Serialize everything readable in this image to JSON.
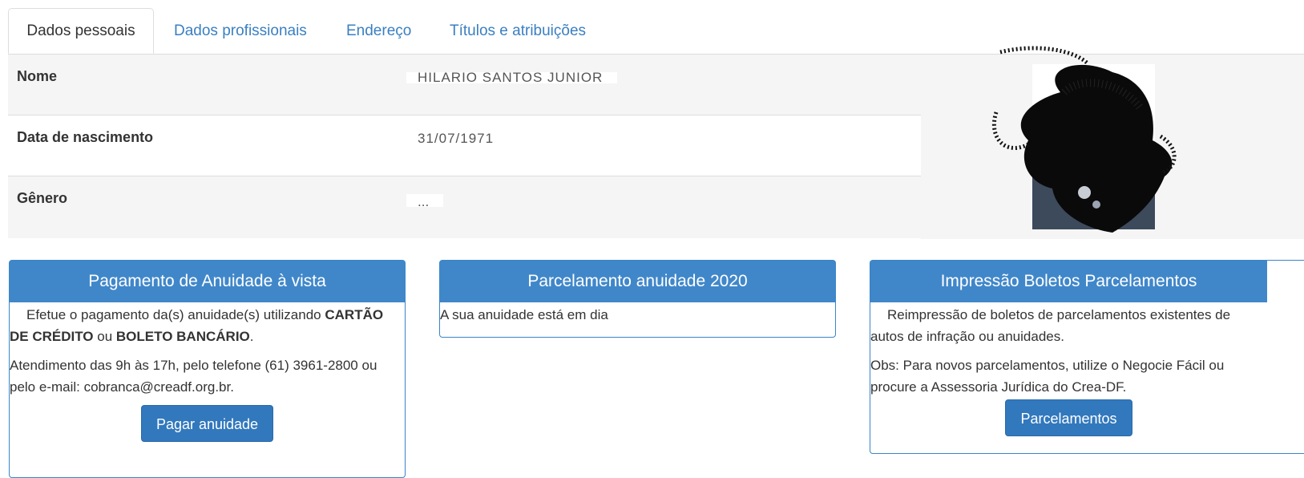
{
  "tabs": [
    {
      "label": "Dados pessoais",
      "active": true
    },
    {
      "label": "Dados profissionais",
      "active": false
    },
    {
      "label": "Endereço",
      "active": false
    },
    {
      "label": "Títulos e atribuições",
      "active": false
    }
  ],
  "personal": {
    "rows": [
      {
        "label": "Nome",
        "value": "HILARIO SANTOS JUNIOR"
      },
      {
        "label": "Data de nascimento",
        "value": "31/07/1971"
      },
      {
        "label": "Gênero",
        "value": "..."
      }
    ]
  },
  "panels": {
    "payment": {
      "title": "Pagamento de Anuidade à vista",
      "line1_pre": "Efetue o pagamento da(s) anuidade(s) utilizando ",
      "bold1": "CARTÃO DE CRÉDITO",
      "mid": " ou ",
      "bold2": "BOLETO BANCÁRIO",
      "end": ".",
      "line2": "Atendimento das 9h às 17h, pelo telefone (61) 3961-2800 ou pelo e-mail: cobranca@creadf.org.br.",
      "button": "Pagar anuidade"
    },
    "installment": {
      "title": "Parcelamento anuidade 2020",
      "text": "A sua anuidade está em dia"
    },
    "reprint": {
      "title": "Impressão Boletos Parcelamentos",
      "line1": "Reimpressão de boletos de parcelamentos existentes de autos de infração ou anuidades.",
      "line2": "Obs: Para novos parcelamentos, utilize o Negocie Fácil ou procure a Assessoria Jurídica do Crea-DF.",
      "button": "Parcelamentos"
    }
  },
  "colors": {
    "primary": "#4087ca",
    "link": "#3a7fc1"
  }
}
